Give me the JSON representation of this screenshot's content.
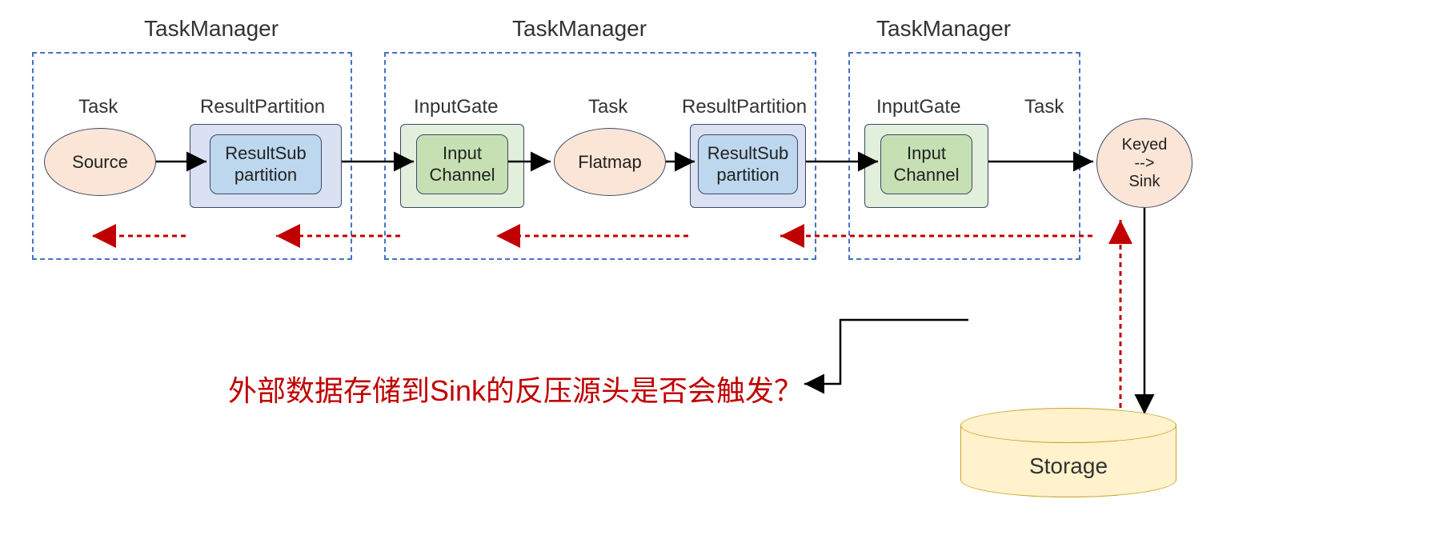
{
  "tm_labels": {
    "tm1": "TaskManager",
    "tm2": "TaskManager",
    "tm3": "TaskManager"
  },
  "tm1": {
    "task_label": "Task",
    "rp_label": "ResultPartition",
    "task_name": "Source",
    "rp_inner": "ResultSub\npartition"
  },
  "tm2": {
    "ig_label": "InputGate",
    "task_label": "Task",
    "rp_label": "ResultPartition",
    "ig_inner": "Input\nChannel",
    "task_name": "Flatmap",
    "rp_inner": "ResultSub\npartition"
  },
  "tm3": {
    "ig_label": "InputGate",
    "task_label": "Task",
    "ig_inner": "Input\nChannel",
    "task_name": "Keyed\n-->\nSink"
  },
  "storage": "Storage",
  "question": "外部数据存储到Sink的反压源头是否会触发？",
  "colors": {
    "dashed_border": "#4472c4",
    "task_fill": "#fbe5d6",
    "rp_fill": "#d9e1f2",
    "rp_inner_fill": "#bdd7ee",
    "ig_fill": "#e2efda",
    "ig_inner_fill": "#c6e0b4",
    "storage_fill": "#fff2cc",
    "arrow": "#000000",
    "red_arrow": "#c00000",
    "question_color": "#c00000"
  }
}
